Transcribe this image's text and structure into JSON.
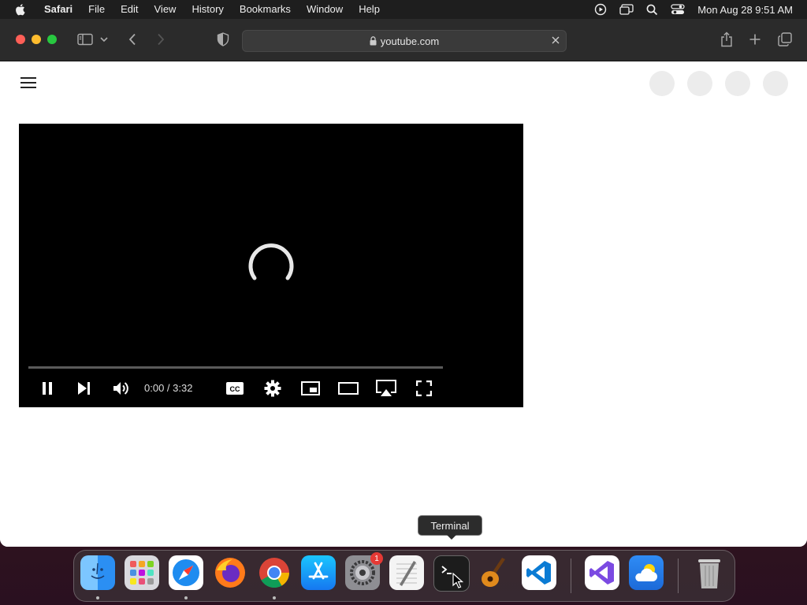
{
  "menubar": {
    "app": "Safari",
    "items": [
      "File",
      "Edit",
      "View",
      "History",
      "Bookmarks",
      "Window",
      "Help"
    ],
    "clock": "Mon Aug 28  9:51 AM"
  },
  "browser": {
    "url": "youtube.com"
  },
  "player": {
    "time": "0:00 / 3:32",
    "progress": 0
  },
  "dock": {
    "tooltip": "Terminal",
    "apps": [
      "Finder",
      "Launchpad",
      "Safari",
      "Firefox",
      "Chrome",
      "App Store",
      "System Settings",
      "TextEdit",
      "Terminal",
      "GarageBand",
      "Visual Studio Code",
      "Visual Studio",
      "Weather",
      "Trash"
    ],
    "settings_badge": "1"
  },
  "colors": {
    "accent_red": "#ff0000",
    "menubar_bg": "#1e1e1e",
    "toolbar_bg": "#2b2b2b"
  }
}
